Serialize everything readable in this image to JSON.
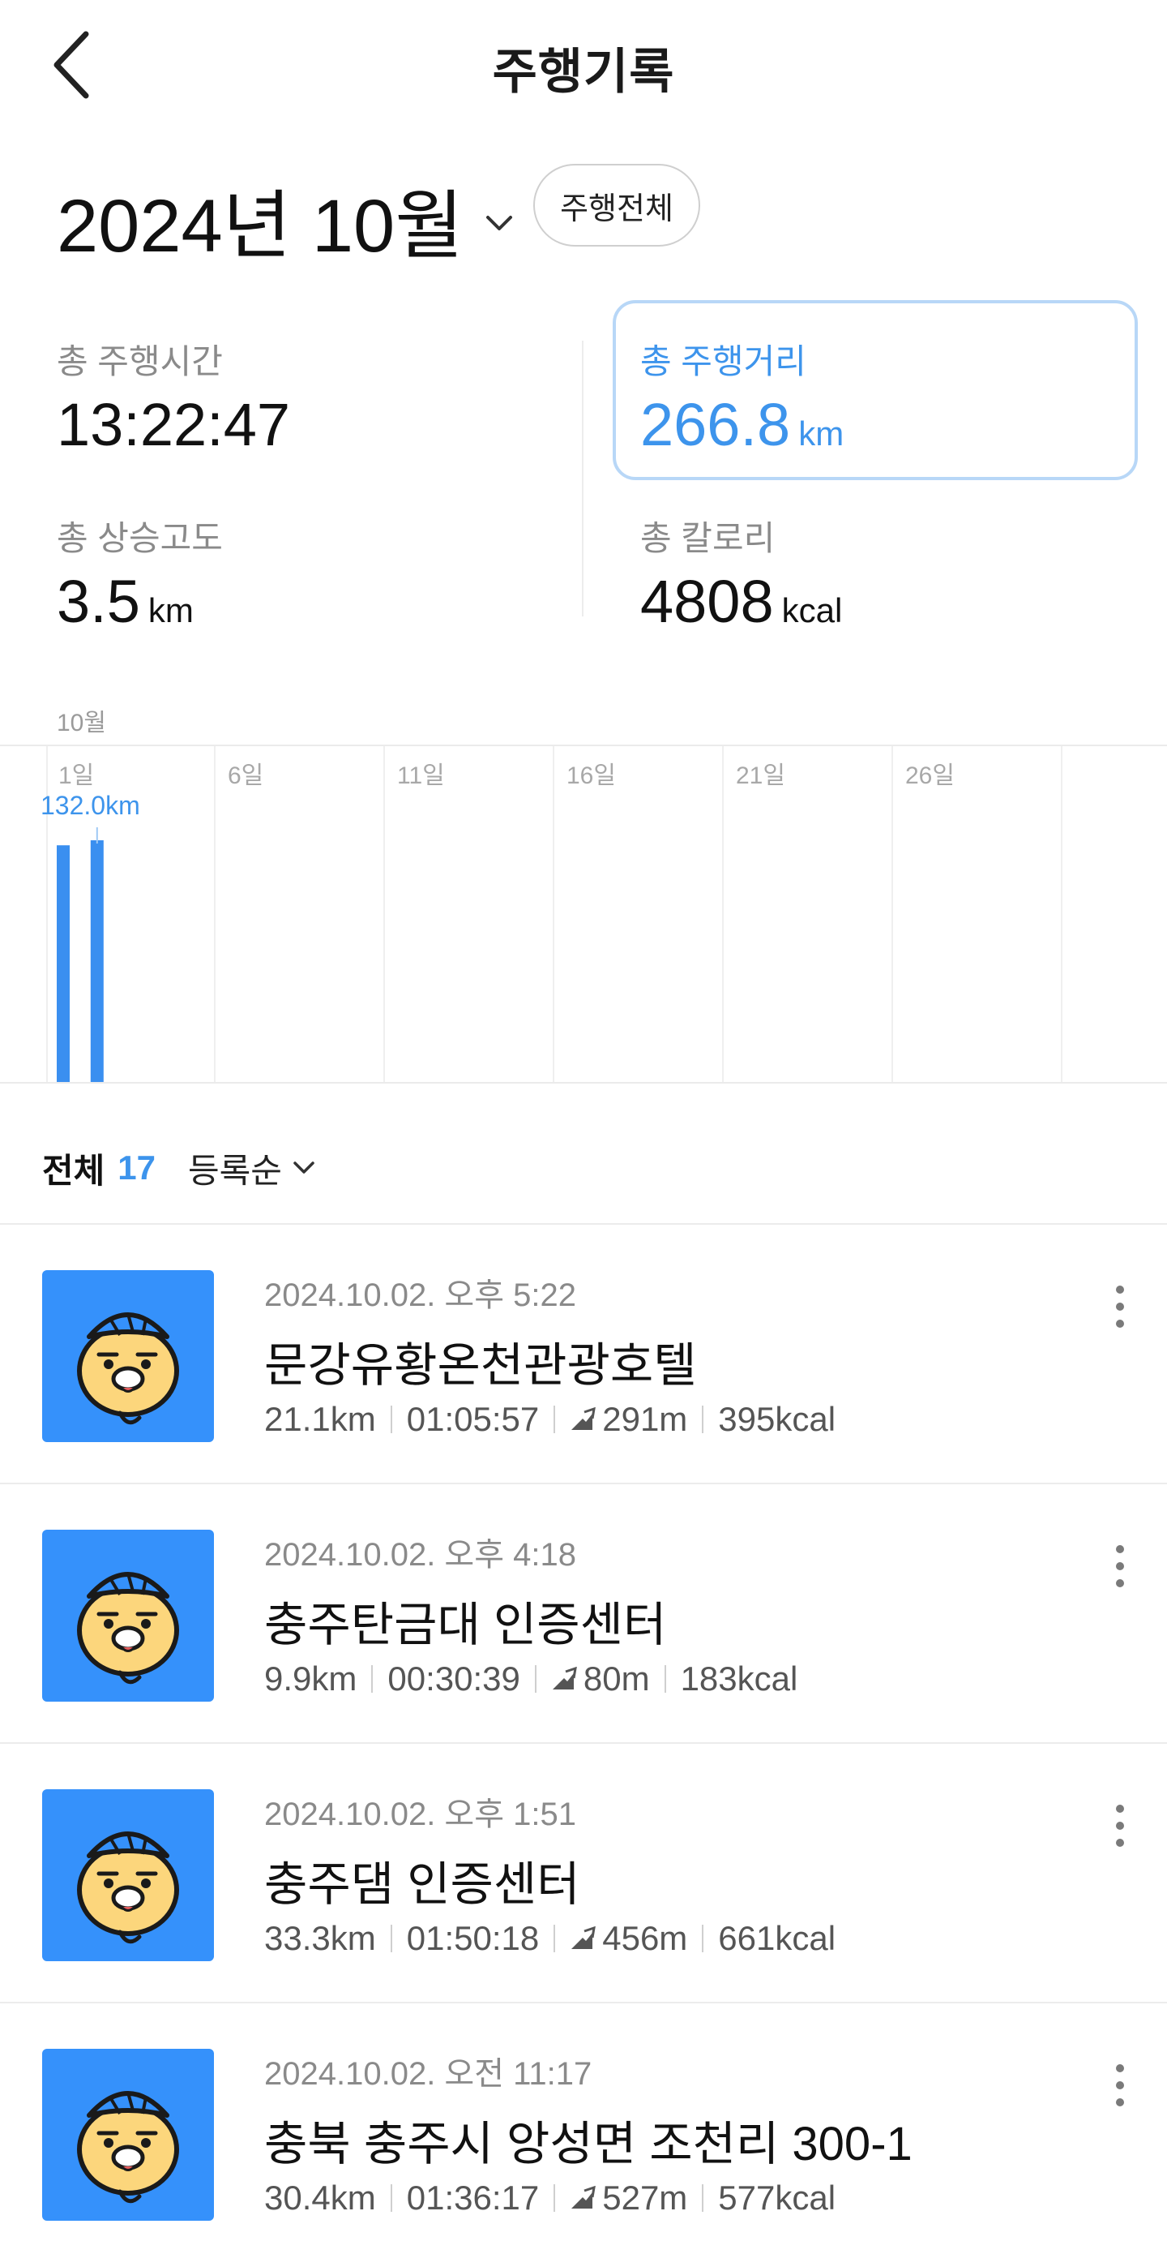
{
  "header": {
    "title": "주행기록"
  },
  "period": {
    "month_label": "2024년 10월",
    "all_rides_button": "주행전체"
  },
  "stats": {
    "time": {
      "label": "총 주행시간",
      "value": "13:22:47",
      "unit": ""
    },
    "distance": {
      "label": "총 주행거리",
      "value": "266.8",
      "unit": "km"
    },
    "elevation": {
      "label": "총 상승고도",
      "value": "3.5",
      "unit": "km"
    },
    "calories": {
      "label": "총 칼로리",
      "value": "4808",
      "unit": "kcal"
    }
  },
  "colors": {
    "accent": "#3d94ec",
    "bar": "#3a8ff0",
    "thumbnail_bg": "#3591fb",
    "highlight_border": "#b8d7f7"
  },
  "chart_data": {
    "type": "bar",
    "title": "",
    "month_label": "10월",
    "x_ticks": [
      "1일",
      "6일",
      "11일",
      "16일",
      "21일",
      "26일"
    ],
    "x_days": [
      1,
      2
    ],
    "values": [
      132.0,
      134.8
    ],
    "unit": "km",
    "data_label": "132.0km",
    "xlabel": "",
    "ylabel": "",
    "grid": true
  },
  "filter": {
    "all_label": "전체",
    "count": "17",
    "sort_label": "등록순"
  },
  "rides": [
    {
      "datetime": "2024.10.02. 오후 5:22",
      "name": "문강유황온천관광호텔",
      "distance": "21.1km",
      "duration": "01:05:57",
      "climb": "291m",
      "calories": "395kcal"
    },
    {
      "datetime": "2024.10.02. 오후 4:18",
      "name": "충주탄금대 인증센터",
      "distance": "9.9km",
      "duration": "00:30:39",
      "climb": "80m",
      "calories": "183kcal"
    },
    {
      "datetime": "2024.10.02. 오후 1:51",
      "name": "충주댐 인증센터",
      "distance": "33.3km",
      "duration": "01:50:18",
      "climb": "456m",
      "calories": "661kcal"
    },
    {
      "datetime": "2024.10.02. 오전 11:17",
      "name": "충북 충주시 앙성면 조천리 300-1",
      "distance": "30.4km",
      "duration": "01:36:17",
      "climb": "527m",
      "calories": "577kcal"
    }
  ]
}
